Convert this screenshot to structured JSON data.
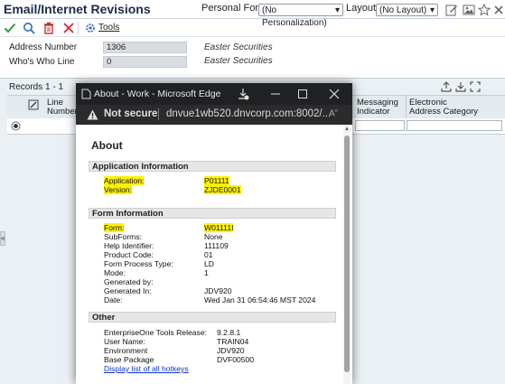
{
  "app": {
    "title": "Email/Internet Revisions",
    "personal_form_label": "Personal Form:",
    "personal_form_value": "(No Personalization)",
    "layout_label": "Layout:",
    "layout_value": "(No Layout)",
    "tools_label": "Tools"
  },
  "fields": {
    "address_number_label": "Address Number",
    "address_number_value": "1306",
    "address_number_desc": "Easter Securities",
    "whos_who_label": "Who's Who Line",
    "whos_who_value": "0",
    "whos_who_desc": "Easter Securities"
  },
  "grid": {
    "records": "Records 1 - 1",
    "columns": {
      "line_1": "Line",
      "line_2": "Number",
      "messaging_1": "Messaging",
      "messaging_2": "Indicator",
      "electronic_1": "Electronic",
      "electronic_2": "Address Category"
    }
  },
  "browser": {
    "title": "About - Work - Microsoft Edge",
    "not_secure": "Not secure",
    "url": "dnvue1wb520.dnvcorp.com:8002/..."
  },
  "about": {
    "heading": "About",
    "app_info_head": "Application Information",
    "app_info": [
      {
        "label": "Application:",
        "value": "P01111"
      },
      {
        "label": "Version:",
        "value": "ZJDE0001"
      }
    ],
    "form_info_head": "Form Information",
    "form_info": [
      {
        "label": "Form:",
        "value": "W01111I"
      },
      {
        "label": "SubForms:",
        "value": "None"
      },
      {
        "label": "Help Identifier:",
        "value": "111109"
      },
      {
        "label": "Product Code:",
        "value": "01"
      },
      {
        "label": "Form Process Type:",
        "value": "LD"
      },
      {
        "label": "Mode:",
        "value": "1"
      },
      {
        "label": "Generated by:",
        "value": ""
      },
      {
        "label": "Generated In:",
        "value": "JDV920"
      },
      {
        "label": "Date:",
        "value": "Wed Jan 31 06:54:46 MST 2024"
      }
    ],
    "other_head": "Other",
    "other": [
      {
        "label": "EnterpriseOne Tools Release:",
        "value": "9.2.8.1"
      },
      {
        "label": "User Name:",
        "value": "TRAIN04"
      },
      {
        "label": "Environment",
        "value": "JDV920"
      },
      {
        "label": "Base Package",
        "value": "DVF00500"
      }
    ],
    "hotkeys_link": "Display list of all hotkeys"
  },
  "colors": {
    "highlight": "#fff200",
    "browser_chrome": "#202124",
    "grid_background": "#eaf0f4"
  }
}
